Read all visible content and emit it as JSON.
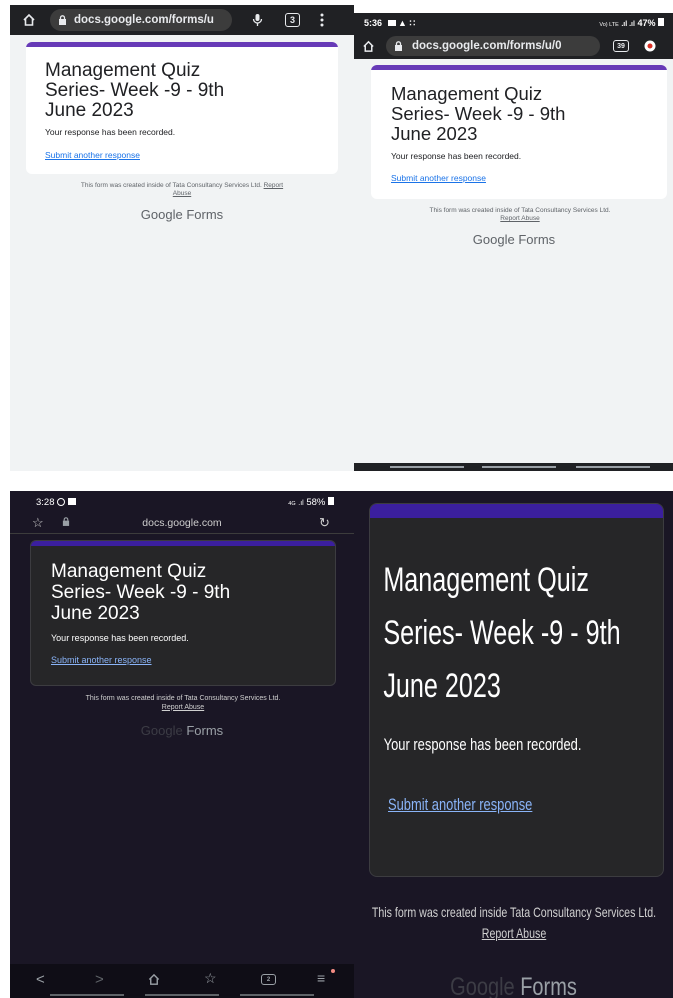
{
  "form": {
    "title": "Management Quiz Series- Week -9 - 9th June 2023",
    "title_lines": [
      "Management Quiz",
      "Series- Week -9 - 9th",
      "June 2023"
    ],
    "confirmation": "Your response has been recorded.",
    "submit_another": "Submit another response",
    "footer_prefix": "This form was created inside of Tata Consultancy Services Ltd.",
    "footer_prefix_alt": "This form was created inside Tata Consultancy Services Ltd.",
    "report": "Report",
    "abuse": "Abuse",
    "report_abuse": "Report Abuse",
    "brand_google": "Google",
    "brand_forms": "Forms"
  },
  "panel1": {
    "url": "docs.google.com/forms/u",
    "tab_count": "3"
  },
  "panel2": {
    "time": "5:36",
    "battery": "47%",
    "net": "Vo) LTE",
    "url": "docs.google.com/forms/u/0",
    "tab_count": "39"
  },
  "panel3": {
    "time": "3:28",
    "battery": "58%",
    "net": "4G",
    "url": "docs.google.com"
  },
  "colors": {
    "accent": "#673ab7",
    "accent_dark": "#3b1f9e",
    "link": "#1a73e8",
    "dark_bg": "#1a1625",
    "dark_card": "#262628"
  }
}
